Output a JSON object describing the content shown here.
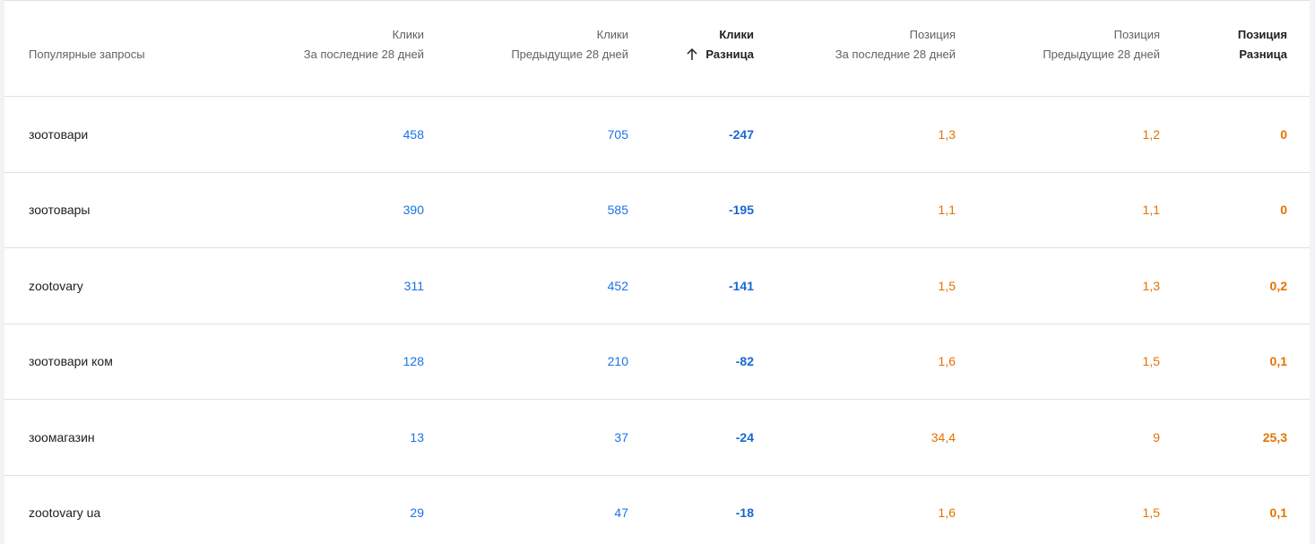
{
  "table": {
    "headers": [
      {
        "line1": "",
        "line2": "Популярные запросы"
      },
      {
        "line1": "Клики",
        "line2": "За последние 28 дней"
      },
      {
        "line1": "Клики",
        "line2": "Предыдущие 28 дней"
      },
      {
        "line1": "Клики",
        "line2": "Разница"
      },
      {
        "line1": "Позиция",
        "line2": "За последние 28 дней"
      },
      {
        "line1": "Позиция",
        "line2": "Предыдущие 28 дней"
      },
      {
        "line1": "Позиция",
        "line2": "Разница"
      }
    ],
    "sort_icon": "arrow-up-icon",
    "colors": {
      "clicks": "#1a73e8",
      "position": "#e37400",
      "text": "#202124",
      "header": "#5f6368"
    },
    "rows": [
      {
        "query": "зоотовари",
        "clicks_28": "458",
        "clicks_prev": "705",
        "clicks_diff": "-247",
        "pos_28": "1,3",
        "pos_prev": "1,2",
        "pos_diff": "0"
      },
      {
        "query": "зоотовары",
        "clicks_28": "390",
        "clicks_prev": "585",
        "clicks_diff": "-195",
        "pos_28": "1,1",
        "pos_prev": "1,1",
        "pos_diff": "0"
      },
      {
        "query": "zootovary",
        "clicks_28": "311",
        "clicks_prev": "452",
        "clicks_diff": "-141",
        "pos_28": "1,5",
        "pos_prev": "1,3",
        "pos_diff": "0,2"
      },
      {
        "query": "зоотовари ком",
        "clicks_28": "128",
        "clicks_prev": "210",
        "clicks_diff": "-82",
        "pos_28": "1,6",
        "pos_prev": "1,5",
        "pos_diff": "0,1"
      },
      {
        "query": "зоомагазин",
        "clicks_28": "13",
        "clicks_prev": "37",
        "clicks_diff": "-24",
        "pos_28": "34,4",
        "pos_prev": "9",
        "pos_diff": "25,3"
      },
      {
        "query": "zootovary ua",
        "clicks_28": "29",
        "clicks_prev": "47",
        "clicks_diff": "-18",
        "pos_28": "1,6",
        "pos_prev": "1,5",
        "pos_diff": "0,1"
      }
    ]
  }
}
